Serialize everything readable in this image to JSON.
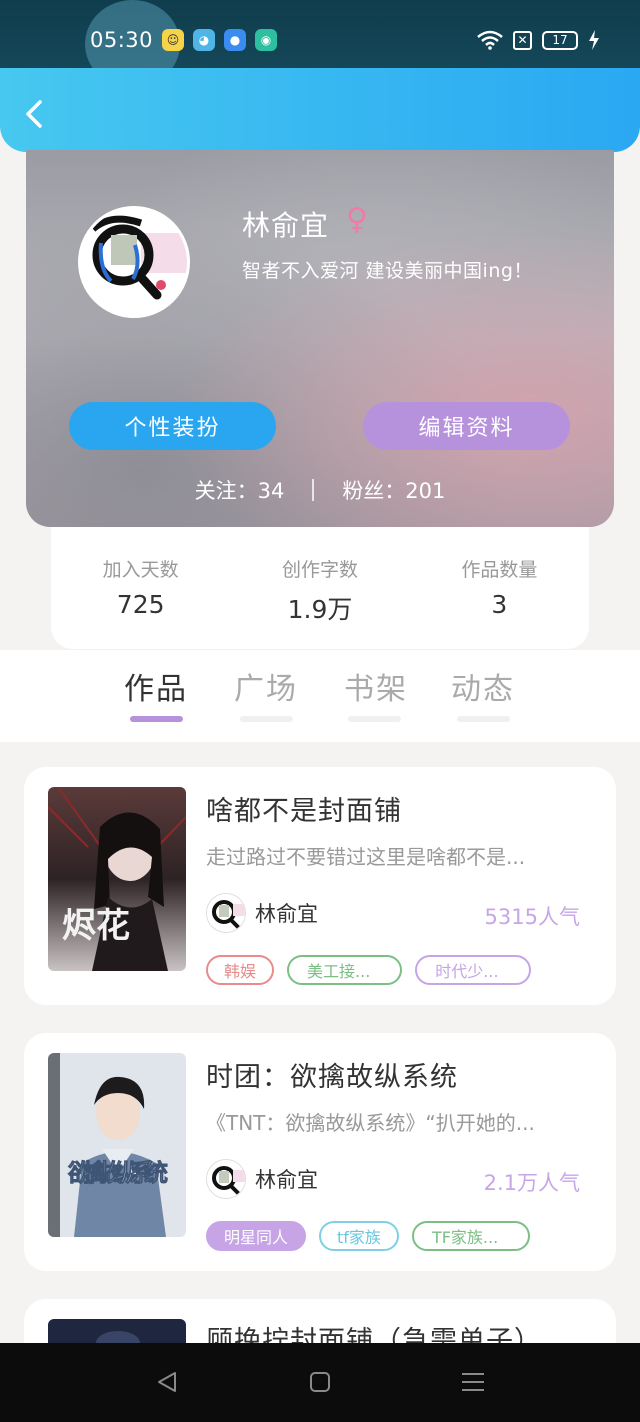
{
  "status_bar": {
    "time": "05:30",
    "battery": "17",
    "icons": [
      "chat-app-icon",
      "face-app-icon",
      "messenger-icon",
      "chat-bubble-icon",
      "wifi-icon",
      "sim-off-icon",
      "battery-icon",
      "charging-icon"
    ]
  },
  "header": {
    "back_icon": "chevron-left-icon"
  },
  "profile": {
    "name": "林俞宜",
    "gender_symbol": "♀",
    "bio": "智者不入爱河 建设美丽中国ing！",
    "dress_button": "个性装扮",
    "edit_button": "编辑资料",
    "following_label": "关注：34",
    "followers_label": "粉丝：201"
  },
  "stats": [
    {
      "label": "加入天数",
      "value": "725"
    },
    {
      "label": "创作字数",
      "value": "1.9万"
    },
    {
      "label": "作品数量",
      "value": "3"
    }
  ],
  "tabs": [
    {
      "label": "作品",
      "active": true
    },
    {
      "label": "广场",
      "active": false
    },
    {
      "label": "书架",
      "active": false
    },
    {
      "label": "动态",
      "active": false
    }
  ],
  "works": [
    {
      "title": "啥都不是封面铺",
      "description": "走过路过不要错过这里是啥都不是...",
      "author": "林俞宜",
      "popularity": "5315人气",
      "tags": [
        {
          "label": "韩娱",
          "color": "#e88b8b"
        },
        {
          "label": "美工接...",
          "color": "#7bbf84"
        },
        {
          "label": "时代少...",
          "color": "#c6a4e6"
        }
      ],
      "cover_text": "烬花"
    },
    {
      "title": "时团：欲擒故纵系统",
      "description": "《TNT：欲擒故纵系统》“扒开她的...",
      "author": "林俞宜",
      "popularity": "2.1万人气",
      "tags": [
        {
          "label": "明星同人",
          "color": "#c6a4e6",
          "filled": true
        },
        {
          "label": "tf家族",
          "color": "#7fd0e6"
        },
        {
          "label": "TF家族...",
          "color": "#7bbf84"
        }
      ],
      "cover_text": "欲擒故纵系统"
    },
    {
      "title": "顾挽拧封面铺（急需单子）"
    }
  ],
  "navbar": {
    "icons": [
      "back-triangle-icon",
      "home-square-icon",
      "menu-lines-icon"
    ]
  }
}
